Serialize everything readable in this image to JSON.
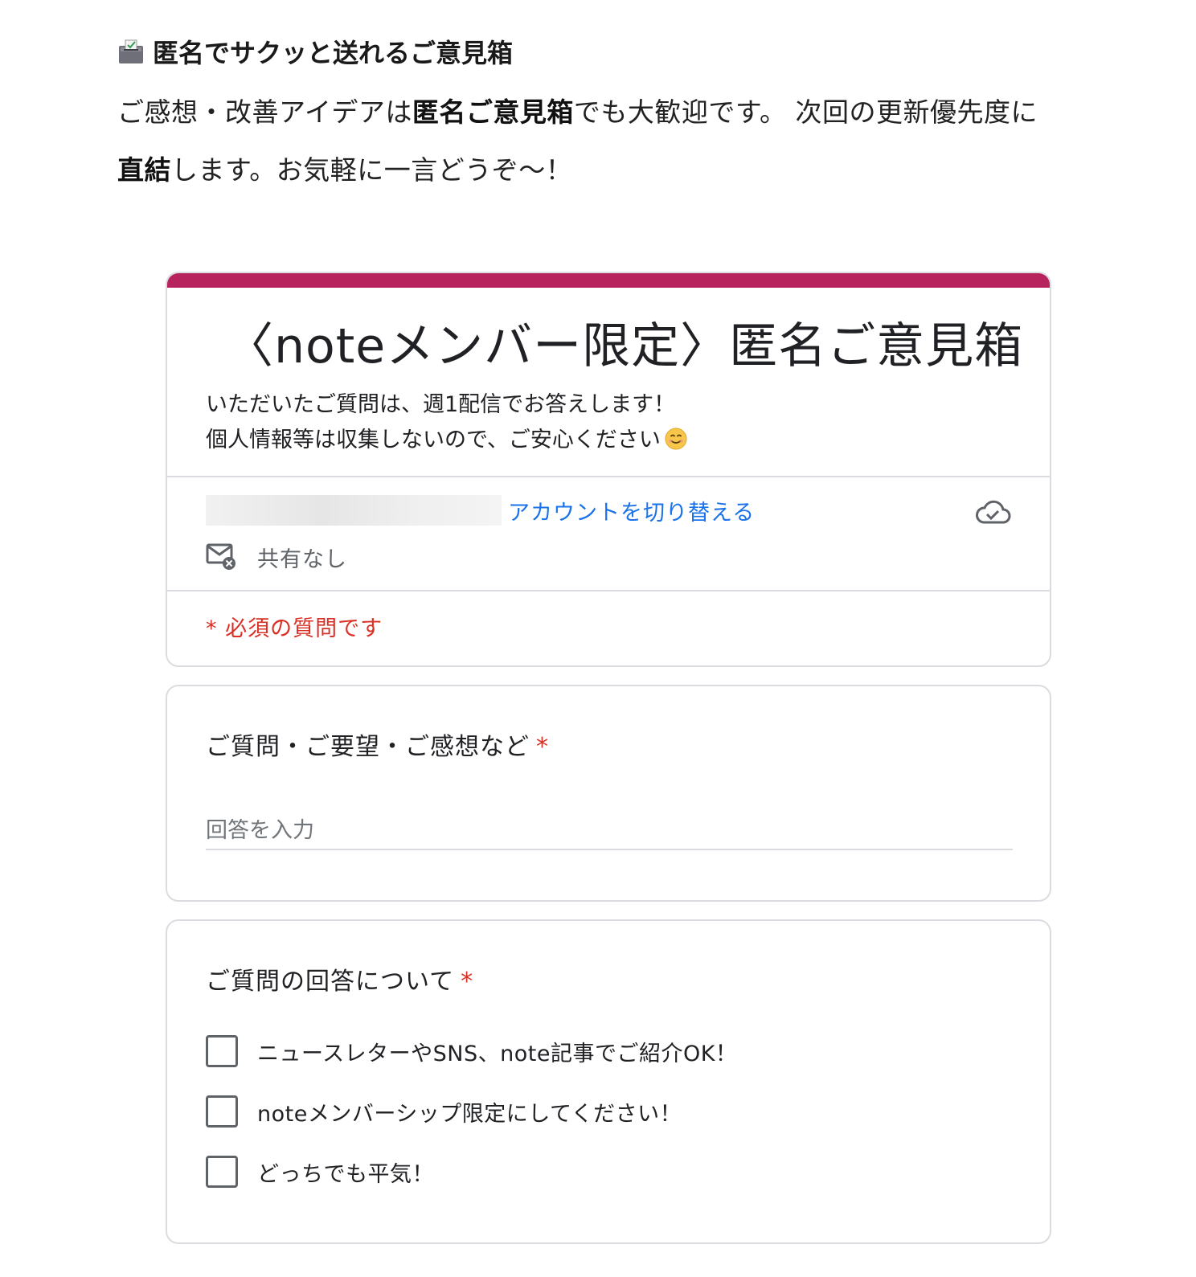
{
  "article": {
    "heading_icon": "ballot-box-icon",
    "heading": "匿名でサクッと送れるご意見箱",
    "intro_part1": "ご感想・改善アイデアは",
    "intro_bold1": "匿名ご意見箱",
    "intro_part2": "でも大歓迎です。 次回の更新優先度に",
    "intro_bold2": "直結",
    "intro_part3": "します。お気軽に一言どうぞ〜！"
  },
  "form": {
    "accent_color": "#b7235d",
    "title": "〈noteメンバー限定〉匿名ご意見箱",
    "description_line1": "いただいたご質問は、週1配信でお答えします！",
    "description_line2": "個人情報等は収集しないので、ご安心ください",
    "switch_account": "アカウントを切り替える",
    "not_shared": "共有なし",
    "required_note": "* 必須の質問です"
  },
  "questions": [
    {
      "label": "ご質問・ご要望・ご感想など",
      "required_mark": "*",
      "placeholder": "回答を入力"
    },
    {
      "label": "ご質問の回答について",
      "required_mark": "*",
      "options": [
        "ニュースレターやSNS、note記事でご紹介OK！",
        "noteメンバーシップ限定にしてください！",
        "どっちでも平気！"
      ]
    }
  ]
}
